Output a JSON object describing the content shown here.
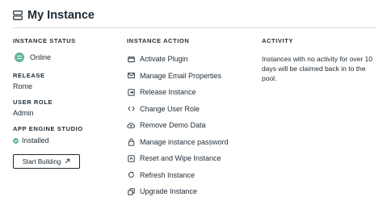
{
  "header": {
    "title": "My Instance",
    "title_icon": "server-icon"
  },
  "instance_status": {
    "label": "INSTANCE STATUS",
    "value": "Online",
    "icon": "online-status-icon",
    "color": "#62b59a"
  },
  "release": {
    "label": "RELEASE",
    "value": "Rome"
  },
  "user_role": {
    "label": "USER ROLE",
    "value": "Admin"
  },
  "app_engine_studio": {
    "label": "APP ENGINE STUDIO",
    "value": "Installed",
    "icon": "check-circle-icon"
  },
  "start_building": {
    "label": "Start Building",
    "icon": "external-arrow-icon"
  },
  "instance_action": {
    "label": "INSTANCE ACTION",
    "items": [
      {
        "label": "Activate Plugin",
        "icon": "plugin-box-icon"
      },
      {
        "label": "Manage Email Properties",
        "icon": "mail-icon"
      },
      {
        "label": "Release Instance",
        "icon": "release-icon"
      },
      {
        "label": "Change User Role",
        "icon": "code-icon"
      },
      {
        "label": "Remove Demo Data",
        "icon": "cloud-icon"
      },
      {
        "label": "Manage instance password",
        "icon": "lock-icon"
      },
      {
        "label": "Reset and Wipe Instance",
        "icon": "reset-icon"
      },
      {
        "label": "Refresh Instance",
        "icon": "refresh-icon"
      },
      {
        "label": "Upgrade Instance",
        "icon": "upgrade-icon"
      }
    ]
  },
  "activity": {
    "label": "ACTIVITY",
    "text": "Instances with no activity for over 10 days will be claimed back in to the pool."
  }
}
